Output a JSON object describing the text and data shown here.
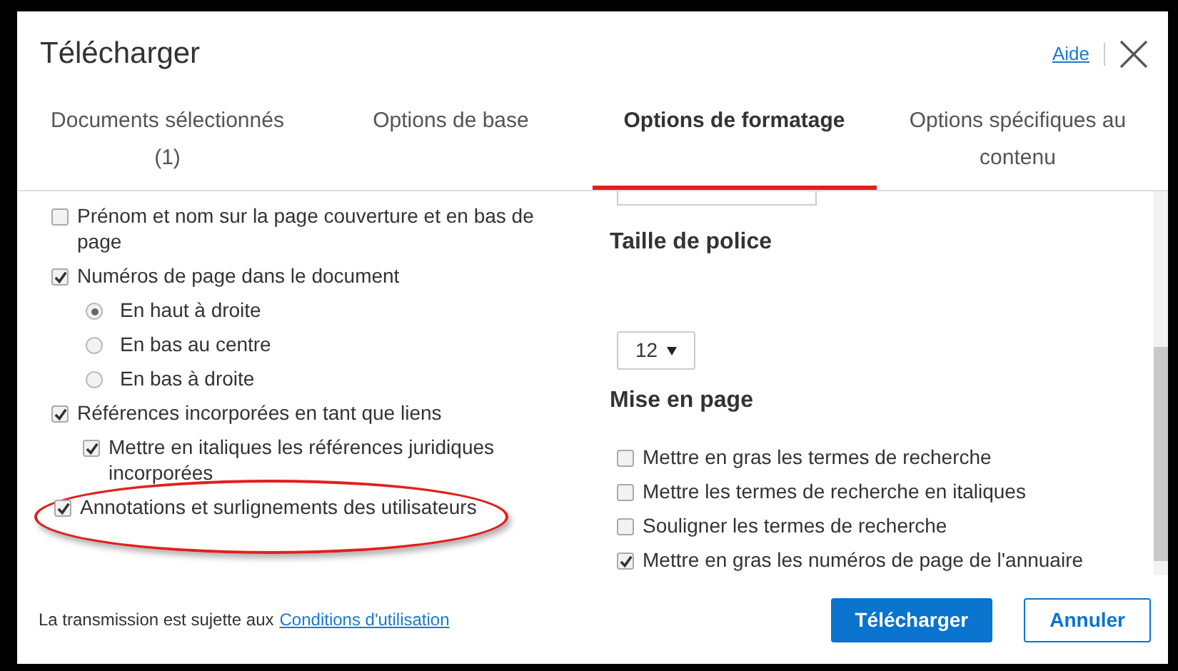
{
  "dialog": {
    "title": "Télécharger",
    "help_link": "Aide"
  },
  "tabs": [
    {
      "label": "Documents sélectionnés (1)",
      "selected": false
    },
    {
      "label": "Options de base",
      "selected": false
    },
    {
      "label": "Options de formatage",
      "selected": true
    },
    {
      "label": "Options spécifiques au contenu",
      "selected": false
    }
  ],
  "left_options": [
    {
      "kind": "checkbox",
      "label": "Prénom et nom sur la page couverture et en bas de page",
      "checked": false
    },
    {
      "kind": "checkbox",
      "label": "Numéros de page dans le document",
      "checked": true,
      "children": [
        {
          "kind": "radio",
          "label": "En haut à droite",
          "checked": true
        },
        {
          "kind": "radio",
          "label": "En bas au centre",
          "checked": false
        },
        {
          "kind": "radio",
          "label": "En bas à droite",
          "checked": false
        }
      ]
    },
    {
      "kind": "checkbox",
      "label": "Références incorporées en tant que liens",
      "checked": true,
      "children": [
        {
          "kind": "checkbox",
          "label": "Mettre en italiques les références juridiques incorporées",
          "checked": true
        }
      ]
    },
    {
      "kind": "checkbox",
      "label": "Annotations et surlignements des utilisateurs",
      "checked": true,
      "highlighted": true
    }
  ],
  "font_size": {
    "heading": "Taille de police",
    "value": "12"
  },
  "layout": {
    "heading": "Mise en page",
    "options": [
      {
        "label": "Mettre en gras les termes de recherche",
        "checked": false
      },
      {
        "label": "Mettre les termes de recherche en italiques",
        "checked": false
      },
      {
        "label": "Souligner les termes de recherche",
        "checked": false
      },
      {
        "label": "Mettre en gras les numéros de page de l'annuaire",
        "checked": true
      }
    ]
  },
  "footer": {
    "notice": "La transmission est sujette aux",
    "terms_link": "Conditions d'utilisation",
    "buttons": [
      {
        "kind": "primary",
        "label": "Télécharger"
      },
      {
        "kind": "secondary",
        "label": "Annuler"
      }
    ]
  }
}
